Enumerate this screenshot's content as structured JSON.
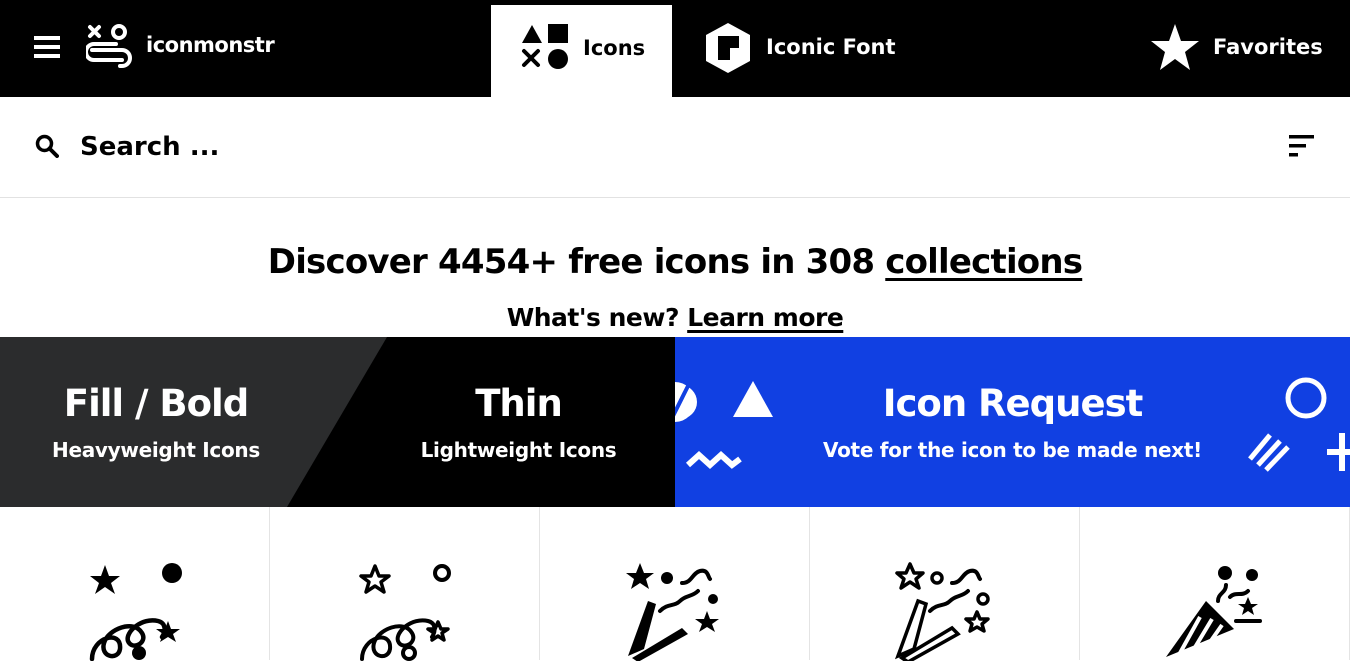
{
  "nav": {
    "brand": "iconmonstr",
    "tabs": [
      {
        "label": "Icons",
        "icon": "shapes-icon",
        "active": true
      },
      {
        "label": "Iconic Font",
        "icon": "iconic-font-icon",
        "active": false
      },
      {
        "label": "Favorites",
        "icon": "star-icon",
        "active": false
      }
    ]
  },
  "search": {
    "placeholder": "Search ..."
  },
  "hero": {
    "headline_prefix": "Discover 4454+ free icons in 308 ",
    "headline_link": "collections",
    "subline_prefix": "What's new? ",
    "subline_link": "Learn more"
  },
  "banners": {
    "fill": {
      "title": "Fill / Bold",
      "subtitle": "Heavyweight Icons"
    },
    "thin": {
      "title": "Thin",
      "subtitle": "Lightweight Icons"
    },
    "request": {
      "title": "Icon Request",
      "subtitle": "Vote for the icon to be made next!"
    }
  },
  "colors": {
    "black": "#000000",
    "dark_grey": "#2b2c2d",
    "request_blue": "#1140e2",
    "white": "#ffffff"
  },
  "grid_icons": [
    "party-confetti-fill-icon",
    "party-confetti-outline-icon",
    "party-popper-fill-icon",
    "party-popper-outline-icon",
    "party-cone-icon"
  ]
}
